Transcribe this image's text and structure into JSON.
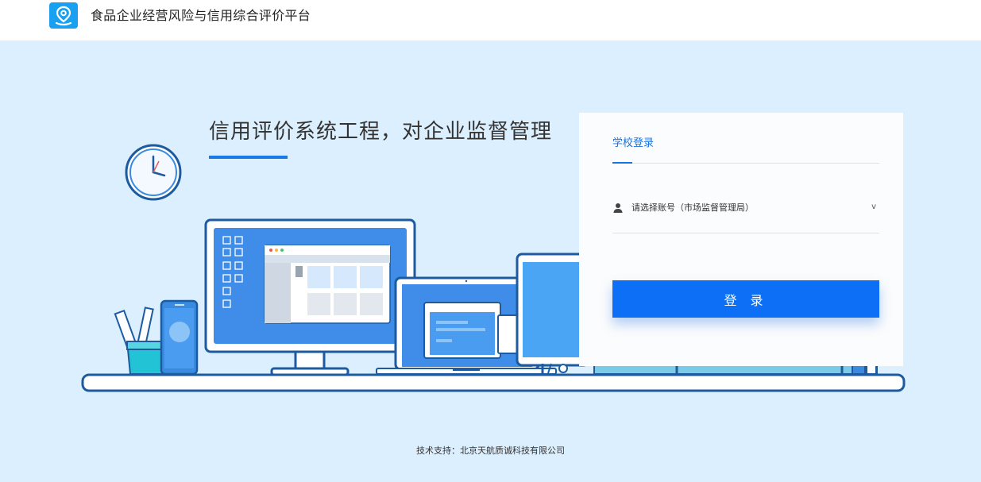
{
  "header": {
    "title": "食品企业经营风险与信用综合评价平台",
    "logo_icon": "location-pin-icon"
  },
  "hero": {
    "slogan": "信用评价系统工程，对企业监督管理"
  },
  "login": {
    "tab_label": "学校登录",
    "account_selected": "请选择账号（市场监督管理局）",
    "chevron": "v",
    "submit_label": "登 录"
  },
  "footer": {
    "support_text": "技术支持：北京天航质诚科技有限公司"
  },
  "colors": {
    "background": "#dcefff",
    "accent": "#0d6ff5",
    "logo": "#1aa0f0"
  }
}
